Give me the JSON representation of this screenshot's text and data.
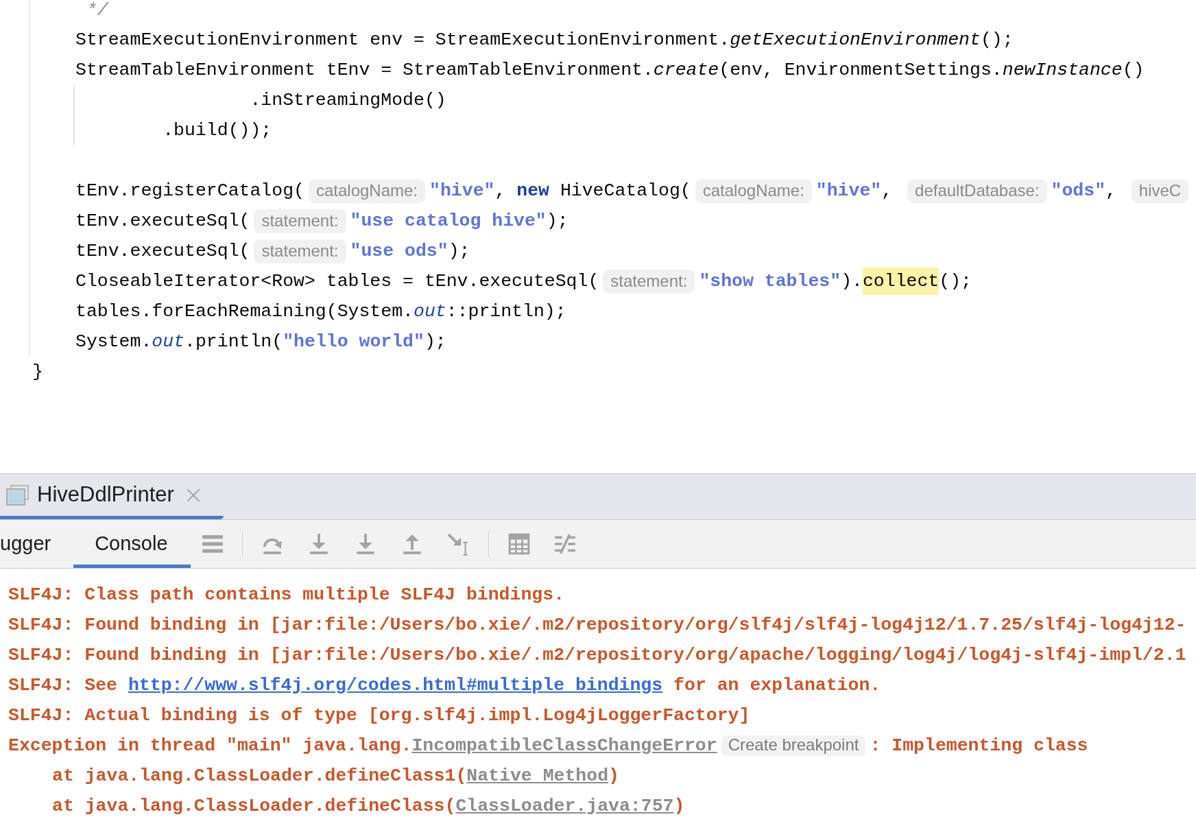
{
  "editor": {
    "method_body": {
      "blocks": [
        {
          "lines": [
            {
              "segments": [
                {
                  "kind": "comment",
                  "text": " */"
                }
              ]
            },
            {
              "segments": [
                {
                  "kind": "code",
                  "text": "StreamExecutionEnvironment env = StreamExecutionEnvironment."
                },
                {
                  "kind": "static_method",
                  "text": "getExecutionEnvironment"
                },
                {
                  "kind": "code",
                  "text": "();"
                }
              ]
            },
            {
              "segments": [
                {
                  "kind": "code",
                  "text": "StreamTableEnvironment tEnv = StreamTableEnvironment."
                },
                {
                  "kind": "static_method",
                  "text": "create"
                },
                {
                  "kind": "code",
                  "text": "(env, EnvironmentSettings."
                },
                {
                  "kind": "static_method",
                  "text": "newInstance"
                },
                {
                  "kind": "code",
                  "text": "()"
                }
              ],
              "children": [
                {
                  "segments": [
                    {
                      "kind": "code",
                      "text": "                .inStreamingMode()"
                    }
                  ]
                },
                {
                  "segments": [
                    {
                      "kind": "code",
                      "text": "        .build());"
                    }
                  ]
                }
              ]
            }
          ]
        },
        {
          "lines": [
            {
              "segments": [
                {
                  "kind": "code",
                  "text": "tEnv.registerCatalog("
                },
                {
                  "kind": "hint",
                  "text": "catalogName:"
                },
                {
                  "kind": "string",
                  "text": "\"hive\""
                },
                {
                  "kind": "code",
                  "text": ", "
                },
                {
                  "kind": "keyword",
                  "text": "new"
                },
                {
                  "kind": "code",
                  "text": " HiveCatalog("
                },
                {
                  "kind": "hint",
                  "text": "catalogName:"
                },
                {
                  "kind": "string",
                  "text": "\"hive\""
                },
                {
                  "kind": "code",
                  "text": ", "
                },
                {
                  "kind": "hint",
                  "text": "defaultDatabase:"
                },
                {
                  "kind": "string",
                  "text": "\"ods\""
                },
                {
                  "kind": "code",
                  "text": ", "
                },
                {
                  "kind": "hint",
                  "text": "hiveC"
                }
              ]
            },
            {
              "segments": [
                {
                  "kind": "code",
                  "text": "tEnv.executeSql("
                },
                {
                  "kind": "hint",
                  "text": "statement:"
                },
                {
                  "kind": "string",
                  "text": "\"use catalog hive\""
                },
                {
                  "kind": "code",
                  "text": ");"
                }
              ]
            },
            {
              "segments": [
                {
                  "kind": "code",
                  "text": "tEnv.executeSql("
                },
                {
                  "kind": "hint",
                  "text": "statement:"
                },
                {
                  "kind": "string",
                  "text": "\"use ods\""
                },
                {
                  "kind": "code",
                  "text": ");"
                }
              ]
            },
            {
              "segments": [
                {
                  "kind": "code",
                  "text": "CloseableIterator<Row> tables = tEnv.executeSql("
                },
                {
                  "kind": "hint",
                  "text": "statement:"
                },
                {
                  "kind": "string",
                  "text": "\"show tables\""
                },
                {
                  "kind": "code",
                  "text": ")."
                },
                {
                  "kind": "highlighted",
                  "text": "collect"
                },
                {
                  "kind": "code",
                  "text": "();"
                }
              ]
            },
            {
              "segments": [
                {
                  "kind": "code",
                  "text": "tables.forEachRemaining(System."
                },
                {
                  "kind": "static_field",
                  "text": "out"
                },
                {
                  "kind": "code",
                  "text": "::println);"
                }
              ]
            },
            {
              "segments": [
                {
                  "kind": "code",
                  "text": "System."
                },
                {
                  "kind": "static_field",
                  "text": "out"
                },
                {
                  "kind": "code",
                  "text": ".println("
                },
                {
                  "kind": "string",
                  "text": "\"hello world\""
                },
                {
                  "kind": "code",
                  "text": ");"
                }
              ]
            }
          ]
        }
      ]
    },
    "closing_brace": "}"
  },
  "run_panel": {
    "tabs": [
      {
        "label": "HiveDdlPrinter",
        "selected": true
      }
    ]
  },
  "debug_panel": {
    "tabs": [
      {
        "label": "ugger",
        "selected": false
      },
      {
        "label": "Console",
        "selected": true
      }
    ]
  },
  "console": {
    "lines": [
      {
        "segments": [
          {
            "kind": "text",
            "text": "SLF4J: Class path contains multiple SLF4J bindings."
          }
        ]
      },
      {
        "segments": [
          {
            "kind": "text",
            "text": "SLF4J: Found binding in [jar:file:/Users/bo.xie/.m2/repository/org/slf4j/slf4j-log4j12/1.7.25/slf4j-log4j12-"
          }
        ]
      },
      {
        "segments": [
          {
            "kind": "text",
            "text": "SLF4J: Found binding in [jar:file:/Users/bo.xie/.m2/repository/org/apache/logging/log4j/log4j-slf4j-impl/2.1"
          }
        ]
      },
      {
        "segments": [
          {
            "kind": "text",
            "text": "SLF4J: See "
          },
          {
            "kind": "link",
            "text": "http://www.slf4j.org/codes.html#multiple_bindings"
          },
          {
            "kind": "text",
            "text": " for an explanation."
          }
        ]
      },
      {
        "segments": [
          {
            "kind": "text",
            "text": "SLF4J: Actual binding is of type [org.slf4j.impl.Log4jLoggerFactory]"
          }
        ]
      },
      {
        "segments": [
          {
            "kind": "text",
            "text": "Exception in thread \"main\" java.lang."
          },
          {
            "kind": "source_link",
            "text": "IncompatibleClassChangeError"
          },
          {
            "kind": "hint",
            "text": "Create breakpoint"
          },
          {
            "kind": "text",
            "text": ": Implementing class"
          }
        ],
        "children": [
          {
            "segments": [
              {
                "kind": "text",
                "text": "at java.lang.ClassLoader.defineClass1("
              },
              {
                "kind": "source_link",
                "text": "Native Method"
              },
              {
                "kind": "text",
                "text": ")"
              }
            ]
          },
          {
            "segments": [
              {
                "kind": "text",
                "text": "at java.lang.ClassLoader.defineClass("
              },
              {
                "kind": "source_link",
                "text": "ClassLoader.java:757"
              },
              {
                "kind": "text",
                "text": ")"
              }
            ]
          }
        ]
      }
    ]
  }
}
